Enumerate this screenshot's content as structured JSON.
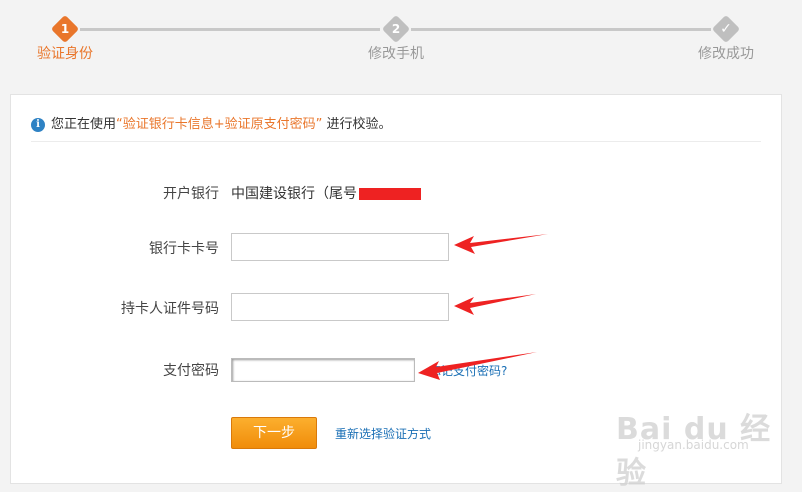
{
  "steps": [
    {
      "number": "1",
      "label": "验证身份",
      "state": "active"
    },
    {
      "number": "2",
      "label": "修改手机",
      "state": "pending"
    },
    {
      "number": "✓",
      "label": "修改成功",
      "state": "pending"
    }
  ],
  "notice": {
    "icon": "info-icon",
    "prefix": "您正在使用",
    "highlight": "“验证银行卡信息+验证原支付密码”",
    "suffix": "进行校验。"
  },
  "form": {
    "bank_label": "开户银行",
    "bank_value": "中国建设银行（尾号",
    "card_label": "银行卡卡号",
    "card_value": "",
    "id_label": "持卡人证件号码",
    "id_value": "",
    "pwd_label": "支付密码",
    "forgot_link": "忘记支付密码?",
    "next_button": "下一步",
    "reselect_link": "重新选择验证方式"
  },
  "watermark": {
    "brand": "Bai du 经验",
    "url": "jingyan.baidu.com"
  },
  "colors": {
    "accent": "#e9762b",
    "link": "#1a6fb5",
    "annotation": "#ee2222"
  }
}
